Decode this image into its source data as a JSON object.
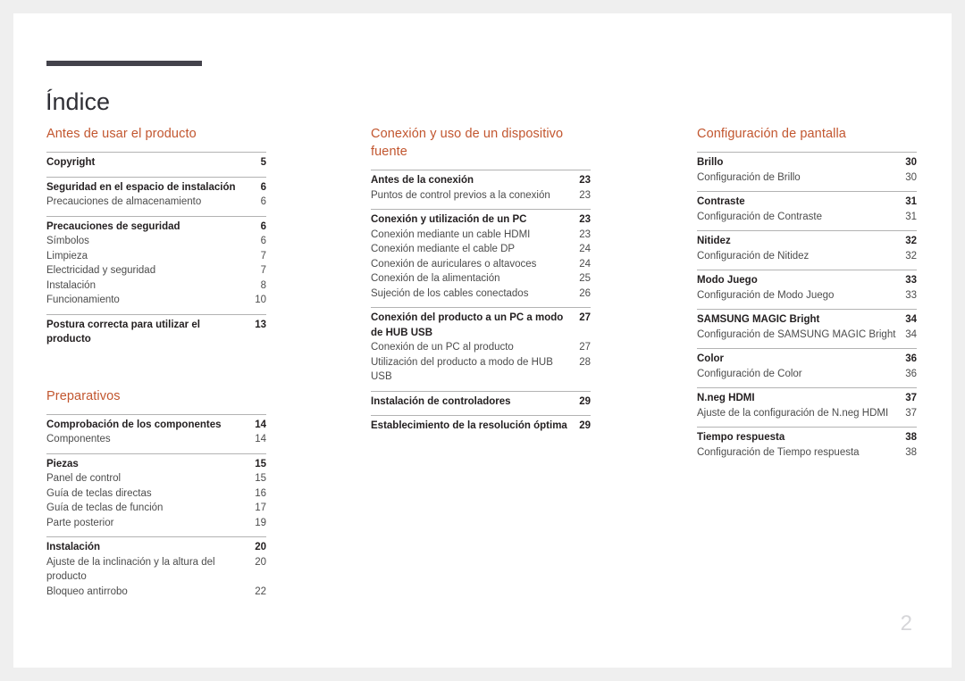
{
  "document": {
    "title": "Índice",
    "folio": "2",
    "accent_color": "#c2562f",
    "rule_color": "#43424b"
  },
  "columns": [
    {
      "name": "column-1",
      "sections": [
        {
          "heading": "Antes de usar el producto",
          "entries": [
            {
              "main": {
                "label": "Copyright",
                "page": "5"
              },
              "subs": []
            },
            {
              "main": {
                "label": "Seguridad en el espacio de instalación",
                "page": "6"
              },
              "subs": [
                {
                  "label": "Precauciones de almacenamiento",
                  "page": "6"
                }
              ]
            },
            {
              "main": {
                "label": "Precauciones de seguridad",
                "page": "6"
              },
              "subs": [
                {
                  "label": "Símbolos",
                  "page": "6"
                },
                {
                  "label": "Limpieza",
                  "page": "7"
                },
                {
                  "label": "Electricidad y seguridad",
                  "page": "7"
                },
                {
                  "label": "Instalación",
                  "page": "8"
                },
                {
                  "label": "Funcionamiento",
                  "page": "10"
                }
              ]
            },
            {
              "main": {
                "label": "Postura correcta para utilizar el producto",
                "page": "13"
              },
              "subs": []
            }
          ]
        },
        {
          "heading": "Preparativos",
          "entries": [
            {
              "main": {
                "label": "Comprobación de los componentes",
                "page": "14"
              },
              "subs": [
                {
                  "label": "Componentes",
                  "page": "14"
                }
              ]
            },
            {
              "main": {
                "label": "Piezas",
                "page": "15"
              },
              "subs": [
                {
                  "label": "Panel de control",
                  "page": "15"
                },
                {
                  "label": "Guía de teclas directas",
                  "page": "16"
                },
                {
                  "label": "Guía de teclas de función",
                  "page": "17"
                },
                {
                  "label": "Parte posterior",
                  "page": "19"
                }
              ]
            },
            {
              "main": {
                "label": "Instalación",
                "page": "20"
              },
              "subs": [
                {
                  "label": "Ajuste de la inclinación y la altura del producto",
                  "page": "20"
                },
                {
                  "label": "Bloqueo antirrobo",
                  "page": "22"
                }
              ]
            }
          ]
        }
      ]
    },
    {
      "name": "column-2",
      "sections": [
        {
          "heading": "Conexión y uso de un dispositivo fuente",
          "entries": [
            {
              "main": {
                "label": "Antes de la conexión",
                "page": "23"
              },
              "subs": [
                {
                  "label": "Puntos de control previos a la conexión",
                  "page": "23"
                }
              ]
            },
            {
              "main": {
                "label": "Conexión y utilización de un PC",
                "page": "23"
              },
              "subs": [
                {
                  "label": "Conexión mediante un cable HDMI",
                  "page": "23"
                },
                {
                  "label": "Conexión mediante el cable DP",
                  "page": "24"
                },
                {
                  "label": "Conexión de auriculares o altavoces",
                  "page": "24"
                },
                {
                  "label": "Conexión de la alimentación",
                  "page": "25"
                },
                {
                  "label": "Sujeción de los cables conectados",
                  "page": "26"
                }
              ]
            },
            {
              "main": {
                "label": "Conexión del producto a un PC a modo de HUB USB",
                "page": "27"
              },
              "subs": [
                {
                  "label": "Conexión de un PC al producto",
                  "page": "27"
                },
                {
                  "label": "Utilización del producto a modo de HUB USB",
                  "page": "28"
                }
              ]
            },
            {
              "main": {
                "label": "Instalación de controladores",
                "page": "29"
              },
              "subs": []
            },
            {
              "main": {
                "label": "Establecimiento de la resolución óptima",
                "page": "29"
              },
              "subs": []
            }
          ]
        }
      ]
    },
    {
      "name": "column-3",
      "sections": [
        {
          "heading": "Configuración de pantalla",
          "entries": [
            {
              "main": {
                "label": "Brillo",
                "page": "30"
              },
              "subs": [
                {
                  "label": "Configuración de Brillo",
                  "page": "30"
                }
              ]
            },
            {
              "main": {
                "label": "Contraste",
                "page": "31"
              },
              "subs": [
                {
                  "label": "Configuración de Contraste",
                  "page": "31"
                }
              ]
            },
            {
              "main": {
                "label": "Nitidez",
                "page": "32"
              },
              "subs": [
                {
                  "label": "Configuración de Nitidez",
                  "page": "32"
                }
              ]
            },
            {
              "main": {
                "label": "Modo Juego",
                "page": "33"
              },
              "subs": [
                {
                  "label": "Configuración de Modo Juego",
                  "page": "33"
                }
              ]
            },
            {
              "main": {
                "label": "SAMSUNG MAGIC Bright",
                "page": "34"
              },
              "subs": [
                {
                  "label": "Configuración de SAMSUNG MAGIC Bright",
                  "page": "34"
                }
              ]
            },
            {
              "main": {
                "label": "Color",
                "page": "36"
              },
              "subs": [
                {
                  "label": "Configuración de Color",
                  "page": "36"
                }
              ]
            },
            {
              "main": {
                "label": "N.neg HDMI",
                "page": "37"
              },
              "subs": [
                {
                  "label": "Ajuste de la configuración de N.neg HDMI",
                  "page": "37"
                }
              ]
            },
            {
              "main": {
                "label": "Tiempo respuesta",
                "page": "38"
              },
              "subs": [
                {
                  "label": "Configuración de Tiempo respuesta",
                  "page": "38"
                }
              ]
            }
          ]
        }
      ]
    }
  ]
}
